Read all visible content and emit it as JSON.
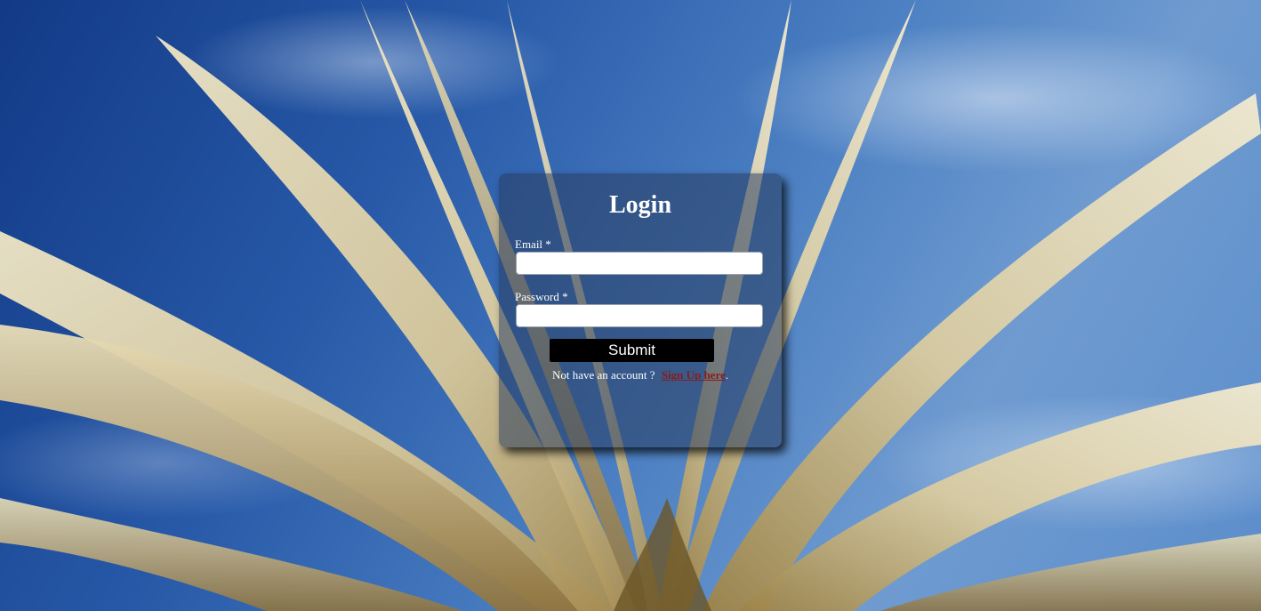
{
  "login": {
    "title": "Login",
    "email_label": "Email *",
    "email_value": "",
    "password_label": "Password *",
    "password_value": "",
    "submit_label": "Submit",
    "signup_prompt": "Not have an account ?",
    "signup_link": "Sign Up here",
    "signup_suffix": "."
  },
  "colors": {
    "card_background": "#283c5f",
    "submit_background": "#000000",
    "signup_link": "#8b1a1a",
    "sky": "#2759a8",
    "pages": "#e8dcb4"
  },
  "background": {
    "subject": "open book with fanned pages against blue sky"
  }
}
